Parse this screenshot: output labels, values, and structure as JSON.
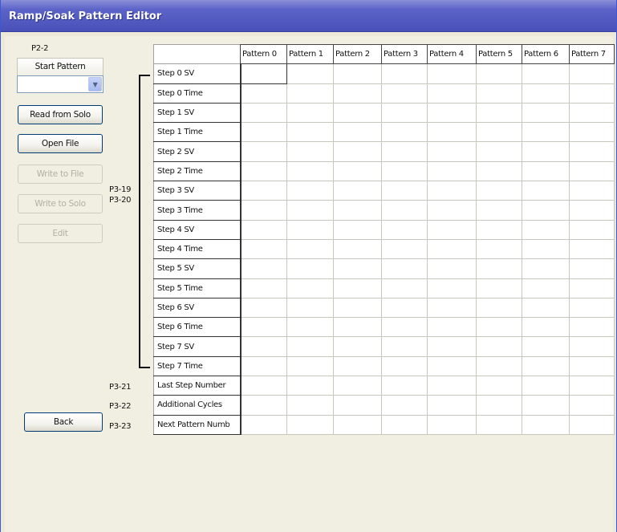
{
  "window": {
    "title": "Ramp/Soak Pattern Editor"
  },
  "sidebar": {
    "param_p22": "P2-2",
    "start_pattern_label": "Start Pattern",
    "start_pattern_value": "",
    "buttons": {
      "read_from_solo": "Read from Solo",
      "open_file": "Open File",
      "write_to_file": "Write to File",
      "write_to_solo": "Write to Solo",
      "edit": "Edit",
      "back": "Back"
    },
    "button_states": {
      "read_from_solo": "enabled",
      "open_file": "enabled",
      "write_to_file": "disabled",
      "write_to_solo": "disabled",
      "edit": "disabled",
      "back": "enabled"
    }
  },
  "param_labels": {
    "p319": "P3-19",
    "p320": "P3-20",
    "p321": "P3-21",
    "p322": "P3-22",
    "p323": "P3-23"
  },
  "grid": {
    "columns": [
      "Pattern 0",
      "Pattern 1",
      "Pattern 2",
      "Pattern 3",
      "Pattern 4",
      "Pattern 5",
      "Pattern 6",
      "Pattern 7"
    ],
    "rows": [
      "Step 0 SV",
      "Step 0 Time",
      "Step 1 SV",
      "Step 1 Time",
      "Step 2 SV",
      "Step 2 Time",
      "Step 3 SV",
      "Step 3 Time",
      "Step 4 SV",
      "Step 4 Time",
      "Step 5 SV",
      "Step 5 Time",
      "Step 6 SV",
      "Step 6 Time",
      "Step 7 SV",
      "Step 7 Time",
      "Last Step Number",
      "Additional Cycles",
      "Next Pattern Numb"
    ],
    "selected_cell": {
      "row": 0,
      "col": 0
    }
  }
}
